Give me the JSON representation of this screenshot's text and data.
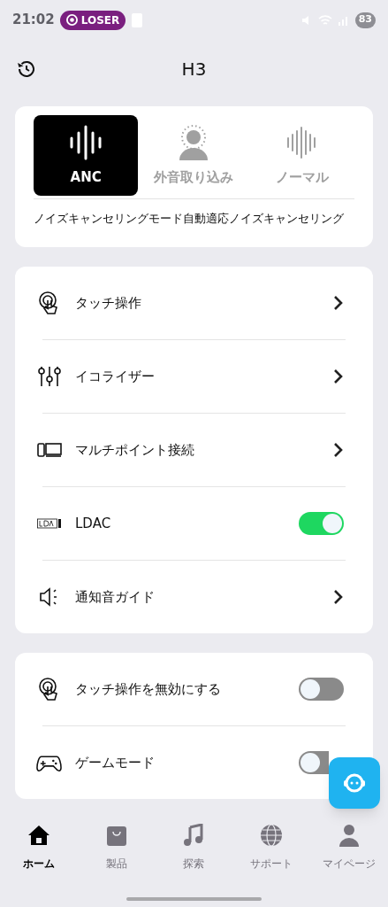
{
  "status_bar": {
    "time": "21:02",
    "badge": "LOSER",
    "battery": "83"
  },
  "header": {
    "title": "H3"
  },
  "modes": [
    {
      "label": "ANC",
      "selected": true
    },
    {
      "label": "外音取り込み",
      "selected": false
    },
    {
      "label": "ノーマル",
      "selected": false
    }
  ],
  "sub_modes": [
    "ノイズキャンセリングモード",
    "自動適応ノイズキャンセリング"
  ],
  "settings": [
    {
      "kind": "link",
      "label": "タッチ操作"
    },
    {
      "kind": "link",
      "label": "イコライザー"
    },
    {
      "kind": "link",
      "label": "マルチポイント接続"
    },
    {
      "kind": "toggle",
      "label": "LDAC",
      "on": true
    },
    {
      "kind": "link",
      "label": "通知音ガイド"
    }
  ],
  "extra_settings": [
    {
      "kind": "toggle",
      "label": "タッチ操作を無効にする",
      "on": false
    },
    {
      "kind": "toggle",
      "label": "ゲームモード",
      "on": false
    }
  ],
  "nav": [
    {
      "label": "ホーム",
      "selected": true
    },
    {
      "label": "製品",
      "selected": false
    },
    {
      "label": "探索",
      "selected": false
    },
    {
      "label": "サポート",
      "selected": false
    },
    {
      "label": "マイページ",
      "selected": false
    }
  ]
}
